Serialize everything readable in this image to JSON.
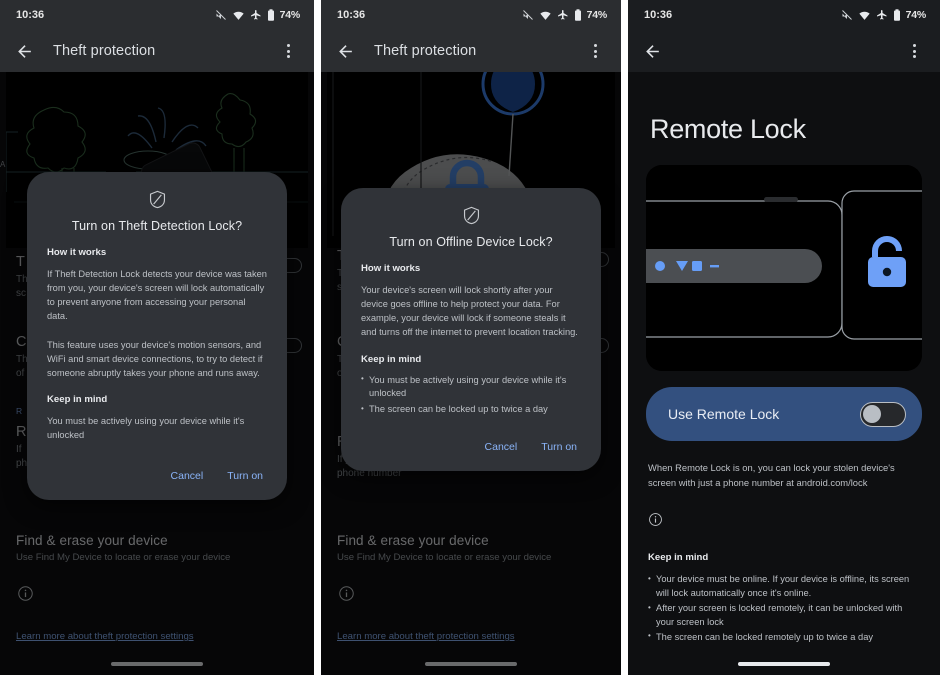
{
  "status_bar": {
    "time": "10:36",
    "battery": "74%",
    "icons": [
      "mute-icon",
      "wifi-icon",
      "airplane-mode-icon",
      "battery-icon"
    ]
  },
  "colors": {
    "accent_blue": "#8ab4f8",
    "card_blue": "#33507f",
    "lock_blue": "#669df6",
    "dialog_surface": "#303338",
    "app_bar": "#2b2d30",
    "page_bg": "#0e0f11"
  },
  "panel1": {
    "app_bar": {
      "title": "Theft protection",
      "back_icon": "back-arrow-icon",
      "overflow_icon": "more-options-icon"
    },
    "background_rows": [
      {
        "heading": "T",
        "sub_line1": "Th",
        "sub_line2": "sc"
      },
      {
        "heading": "C",
        "sub_line1": "Th",
        "sub_line2": "of"
      },
      {
        "heading": "R",
        "sub_line1": "If",
        "sub_line2": "ph"
      }
    ],
    "background_label": "A",
    "background_label2": "R",
    "dialog": {
      "icon": "theft-protection-shield-icon",
      "title": "Turn on Theft Detection Lock?",
      "how_heading": "How it works",
      "how_paragraphs": [
        "If Theft Detection Lock detects your device was taken from you, your device's screen will lock automatically to prevent anyone from accessing your personal data.",
        "This feature uses your device's motion sensors, and WiFi and smart device connections, to try to detect if someone abruptly takes your phone and runs away."
      ],
      "keep_heading": "Keep in mind",
      "keep_paragraph": "You must be actively using your device while it's unlocked",
      "cancel_label": "Cancel",
      "confirm_label": "Turn on"
    },
    "bottom": {
      "section_title": "Find & erase your device",
      "section_sub": "Use Find My Device to locate or erase your device",
      "info_icon": "info-icon",
      "link": "Learn more about theft protection settings"
    }
  },
  "panel2": {
    "app_bar": {
      "title": "Theft protection",
      "back_icon": "back-arrow-icon",
      "overflow_icon": "more-options-icon"
    },
    "background_rows": [
      {
        "heading": "T",
        "sub_line1": "Th",
        "sub_line2": "sc"
      },
      {
        "heading": "C",
        "sub_line1": "Th",
        "sub_line2": "of"
      },
      {
        "heading": "R",
        "sub_line1": "If y",
        "sub_line2": "phone number"
      }
    ],
    "dialog": {
      "icon": "theft-protection-shield-icon",
      "title": "Turn on Offline Device Lock?",
      "how_heading": "How it works",
      "how_paragraphs": [
        "Your device's screen will lock shortly after your device goes offline to help protect your data. For example, your device will lock if someone steals it and turns off the internet to prevent location tracking."
      ],
      "keep_heading": "Keep in mind",
      "keep_bullets": [
        "You must be actively using your device while it's unlocked",
        "The screen can be locked up to twice a day"
      ],
      "cancel_label": "Cancel",
      "confirm_label": "Turn on"
    },
    "bottom": {
      "section_title": "Find & erase your device",
      "section_sub": "Use Find My Device to locate or erase your device",
      "info_icon": "info-icon",
      "link": "Learn more about theft protection settings"
    }
  },
  "panel3": {
    "app_bar": {
      "back_icon": "back-arrow-icon",
      "overflow_icon": "more-options-icon"
    },
    "page_title": "Remote Lock",
    "illustration": "phone-with-unlocked-padlock-illustration",
    "toggle": {
      "label": "Use Remote Lock",
      "state": "off"
    },
    "description": "When Remote Lock is on, you can lock your stolen device's screen with just a phone number at android.com/lock",
    "info_icon": "info-icon",
    "keep_heading": "Keep in mind",
    "keep_bullets": [
      "Your device must be online. If your device is offline, its screen will lock automatically once it's online.",
      "After your screen is locked remotely, it can be unlocked with your screen lock",
      "The screen can be locked remotely up to twice a day"
    ]
  }
}
